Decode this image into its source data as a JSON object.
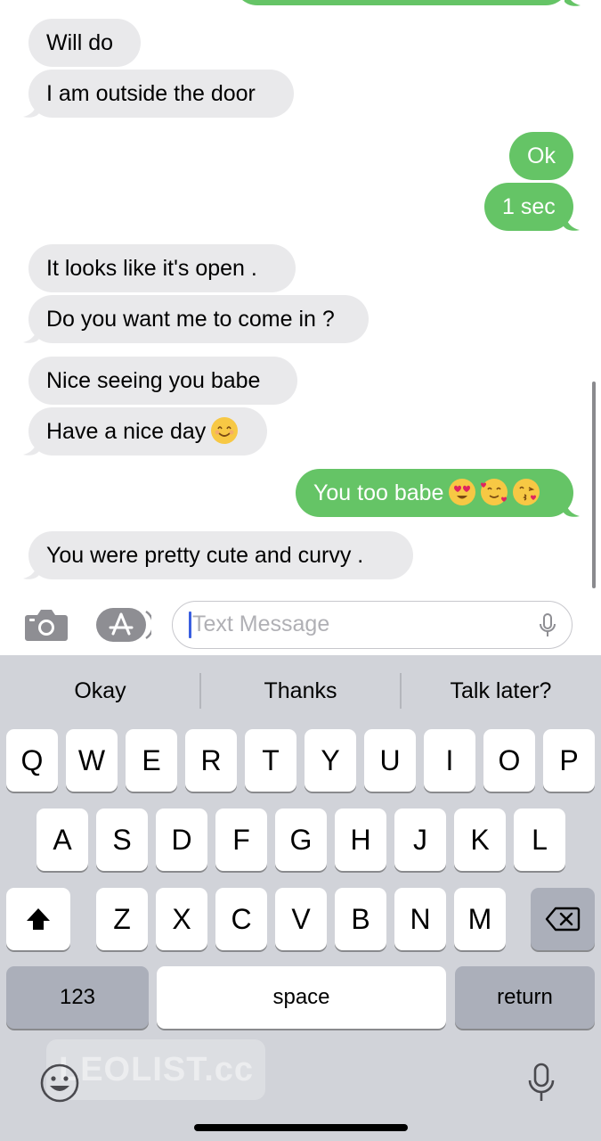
{
  "messages": [
    {
      "text": "Will do",
      "direction": "incoming"
    },
    {
      "text": "I am outside the door",
      "direction": "incoming"
    },
    {
      "text": "Ok",
      "direction": "outgoing"
    },
    {
      "text": "1 sec",
      "direction": "outgoing"
    },
    {
      "text": "It looks like it's open .",
      "direction": "incoming"
    },
    {
      "text": "Do you want me to come in ?",
      "direction": "incoming"
    },
    {
      "text": "Nice seeing you babe",
      "direction": "incoming"
    },
    {
      "text": "Have a nice day",
      "direction": "incoming",
      "emoji": [
        "smiling-face-icon"
      ]
    },
    {
      "text": "You too babe",
      "direction": "outgoing",
      "emoji": [
        "heart-eyes-icon",
        "smiling-face-with-hearts-icon",
        "face-blowing-kiss-icon"
      ]
    },
    {
      "text": "You were pretty cute and curvy .",
      "direction": "incoming"
    }
  ],
  "input": {
    "placeholder": "Text Message",
    "value": ""
  },
  "suggestions": [
    "Okay",
    "Thanks",
    "Talk later?"
  ],
  "keyboard": {
    "row1": [
      "Q",
      "W",
      "E",
      "R",
      "T",
      "Y",
      "U",
      "I",
      "O",
      "P"
    ],
    "row2": [
      "A",
      "S",
      "D",
      "F",
      "G",
      "H",
      "J",
      "K",
      "L"
    ],
    "row3": [
      "Z",
      "X",
      "C",
      "V",
      "B",
      "N",
      "M"
    ],
    "numbers_label": "123",
    "space_label": "space",
    "return_label": "return"
  },
  "watermark": "LEOLIST.cc",
  "colors": {
    "incoming_bubble": "#e9e9eb",
    "outgoing_bubble": "#65c466",
    "keyboard_bg": "#d1d3d9",
    "key_bg": "#ffffff",
    "special_key_bg": "#abafba"
  }
}
